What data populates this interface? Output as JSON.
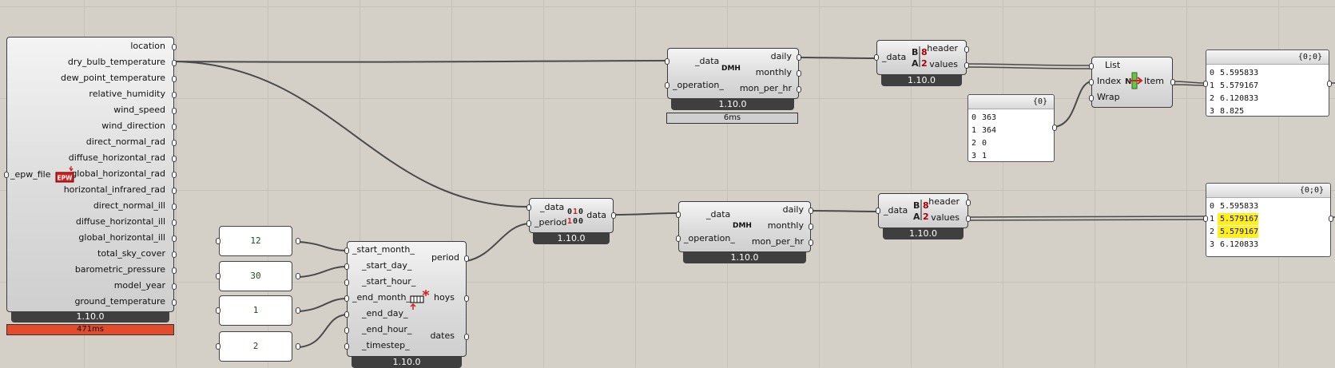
{
  "epw_component": {
    "input_label": "_epw_file",
    "icon_label": "EPW",
    "outputs": [
      "location",
      "dry_bulb_temperature",
      "dew_point_temperature",
      "relative_humidity",
      "wind_speed",
      "wind_direction",
      "direct_normal_rad",
      "diffuse_horizontal_rad",
      "global_horizontal_rad",
      "horizontal_infrared_rad",
      "direct_normal_ill",
      "diffuse_horizontal_ill",
      "global_horizontal_ill",
      "total_sky_cover",
      "barometric_pressure",
      "model_year",
      "ground_temperature"
    ],
    "version": "1.10.0",
    "time": "471ms"
  },
  "dmh_top": {
    "inputs": [
      "_data",
      "_operation_"
    ],
    "outputs": [
      "daily",
      "monthly",
      "mon_per_hr"
    ],
    "icon_label": "DMH",
    "version": "1.10.0",
    "time": "6ms"
  },
  "deconstruct_top": {
    "inputs": [
      "_data"
    ],
    "outputs": [
      "header",
      "values"
    ],
    "version": "1.10.0"
  },
  "list_item": {
    "inputs": [
      "List",
      "Index",
      "Wrap"
    ],
    "outputs": [
      "Item"
    ]
  },
  "panel_index": {
    "header": "{0}",
    "rows": [
      {
        "i": "0",
        "v": "363"
      },
      {
        "i": "1",
        "v": "364"
      },
      {
        "i": "2",
        "v": "0"
      },
      {
        "i": "3",
        "v": "1"
      }
    ]
  },
  "panel_top_result": {
    "header": "{0;0}",
    "rows": [
      {
        "i": "0",
        "v": "5.595833"
      },
      {
        "i": "1",
        "v": "5.579167"
      },
      {
        "i": "2",
        "v": "6.120833"
      },
      {
        "i": "3",
        "v": "8.825"
      }
    ]
  },
  "apply_period": {
    "inputs": [
      "_data",
      "_period"
    ],
    "outputs": [
      "data"
    ],
    "version": "1.10.0"
  },
  "dmh_bottom": {
    "inputs": [
      "_data",
      "_operation_"
    ],
    "outputs": [
      "daily",
      "monthly",
      "mon_per_hr"
    ],
    "icon_label": "DMH",
    "version": "1.10.0"
  },
  "deconstruct_bottom": {
    "inputs": [
      "_data"
    ],
    "outputs": [
      "header",
      "values"
    ],
    "version": "1.10.0"
  },
  "panel_bottom_result": {
    "header": "{0;0}",
    "rows": [
      {
        "i": "0",
        "v": "5.595833",
        "hl": false
      },
      {
        "i": "1",
        "v": "5.579167",
        "hl": true
      },
      {
        "i": "2",
        "v": "5.579167",
        "hl": true
      },
      {
        "i": "3",
        "v": "6.120833",
        "hl": false
      }
    ]
  },
  "sliders": [
    "12",
    "30",
    "1",
    "2"
  ],
  "analysis_period": {
    "inputs": [
      "_start_month_",
      "_start_day_",
      "_start_hour_",
      "_end_month_",
      "_end_day_",
      "_end_hour_",
      "_timestep_"
    ],
    "outputs": [
      "period",
      "hoys",
      "dates"
    ],
    "version": "1.10.0"
  },
  "colors": {
    "canvas": "#d4d0c8",
    "wire": "#4a4a4a",
    "highlight": "#ffee22",
    "error_bar": "#e24b2c"
  }
}
